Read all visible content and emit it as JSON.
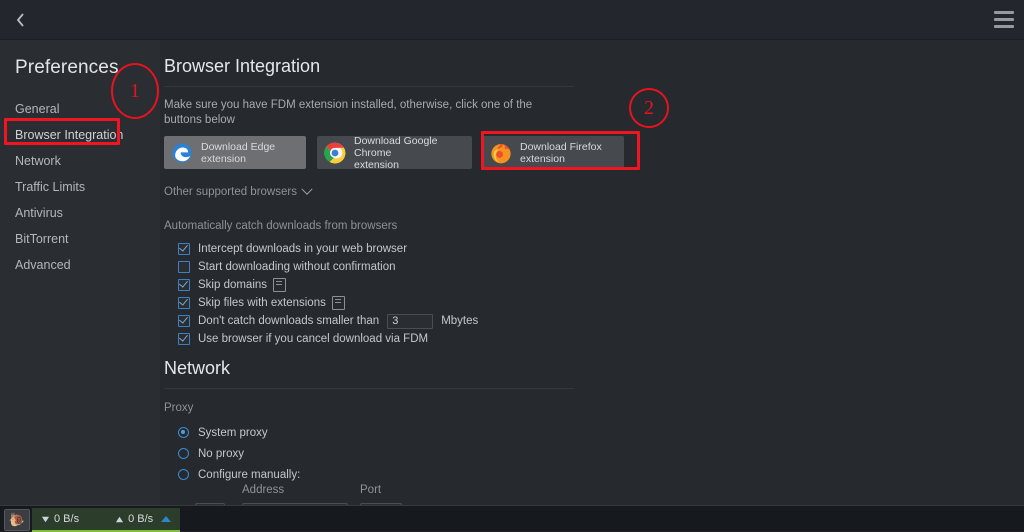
{
  "window": {
    "back_icon": "chevron-left-icon",
    "menu_icon": "hamburger-menu-icon"
  },
  "sidebar": {
    "title": "Preferences",
    "items": [
      {
        "label": "General",
        "active": false
      },
      {
        "label": "Browser Integration",
        "active": true
      },
      {
        "label": "Network",
        "active": false
      },
      {
        "label": "Traffic Limits",
        "active": false
      },
      {
        "label": "Antivirus",
        "active": false
      },
      {
        "label": "BitTorrent",
        "active": false
      },
      {
        "label": "Advanced",
        "active": false
      }
    ]
  },
  "browser_integration": {
    "heading": "Browser Integration",
    "description": "Make sure you have FDM extension installed, otherwise, click one of the buttons below",
    "buttons": [
      {
        "label": "Download Edge\nextension",
        "icon": "edge-logo-icon",
        "highlighted": true
      },
      {
        "label": "Download Google Chrome\nextension",
        "icon": "chrome-logo-icon",
        "highlighted": false
      },
      {
        "label": "Download Firefox\nextension",
        "icon": "firefox-logo-icon",
        "highlighted": false
      }
    ],
    "other_browsers": "Other supported browsers",
    "auto_catch_label": "Automatically catch downloads from browsers",
    "checkboxes": [
      {
        "label": "Intercept downloads in your web browser",
        "checked": true,
        "note": false
      },
      {
        "label": "Start downloading without confirmation",
        "checked": false,
        "note": false
      },
      {
        "label": "Skip domains",
        "checked": true,
        "note": true
      },
      {
        "label": "Skip files with extensions",
        "checked": true,
        "note": true
      },
      {
        "label": "Don't catch downloads smaller than",
        "checked": true,
        "note": false,
        "input_value": "3",
        "unit": "Mbytes"
      },
      {
        "label": "Use browser if you cancel download via FDM",
        "checked": true,
        "note": false
      }
    ]
  },
  "network": {
    "heading": "Network",
    "proxy_label": "Proxy",
    "options": [
      {
        "label": "System proxy",
        "selected": true
      },
      {
        "label": "No proxy",
        "selected": false
      },
      {
        "label": "Configure manually:",
        "selected": false
      }
    ],
    "address_label": "Address",
    "port_label": "Port"
  },
  "statusbar": {
    "snail_icon": "snail-speed-limit-icon",
    "download_speed": "0 B/s",
    "upload_speed": "0 B/s",
    "download_icon": "arrow-down-icon",
    "upload_icon": "arrow-up-icon",
    "expand_icon": "caret-up-icon"
  },
  "annotations": [
    {
      "id": "1",
      "kind": "circle",
      "target": "sidebar-item-browser-integration"
    },
    {
      "id": "2",
      "kind": "circle",
      "target": "download-firefox-extension-button"
    }
  ],
  "colors": {
    "annotation_red": "#ee1520",
    "accent_blue": "#3d8ad1",
    "speed_green": "#7ec13d",
    "window_bg": "#26292d",
    "sidebar_bg": "#2a2d31",
    "titlebar_bg": "#23262d"
  }
}
